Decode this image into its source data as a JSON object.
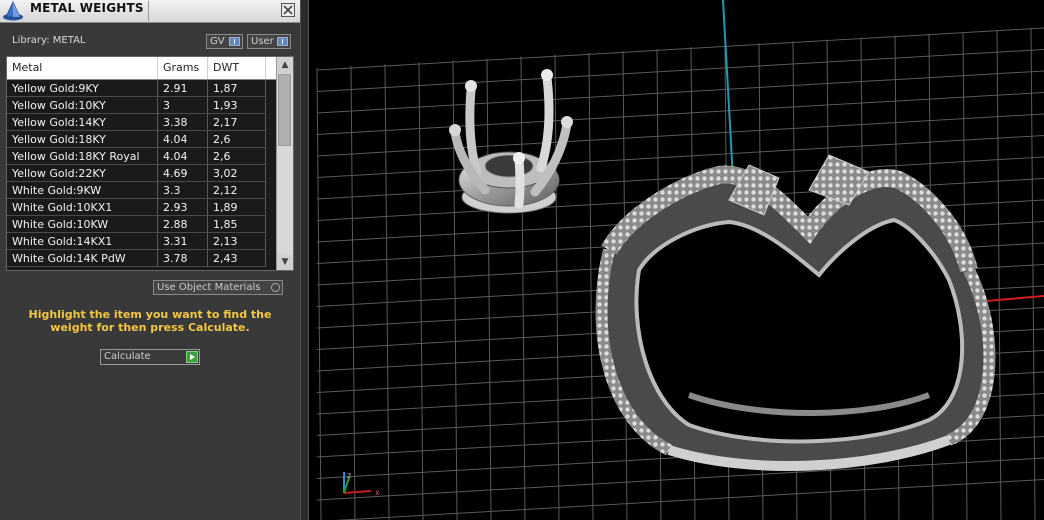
{
  "panel": {
    "title": "METAL WEIGHTS",
    "library_label": "Library: METAL",
    "tag_gv": "GV",
    "tag_user": "User",
    "use_object_materials": "Use Object Materials",
    "hint": "Highlight the item you want to find the weight for then press Calculate.",
    "calculate_label": "Calculate"
  },
  "table": {
    "columns": [
      "Metal",
      "Grams",
      "DWT"
    ],
    "rows": [
      [
        "Yellow Gold:9KY",
        "2.91",
        "1,87"
      ],
      [
        "Yellow Gold:10KY",
        "3",
        "1,93"
      ],
      [
        "Yellow Gold:14KY",
        "3.38",
        "2,17"
      ],
      [
        "Yellow Gold:18KY",
        "4.04",
        "2,6"
      ],
      [
        "Yellow Gold:18KY Royal",
        "4.04",
        "2,6"
      ],
      [
        "Yellow Gold:22KY",
        "4.69",
        "3,02"
      ],
      [
        "White Gold:9KW",
        "3.3",
        "2,12"
      ],
      [
        "White Gold:10KX1",
        "2.93",
        "1,89"
      ],
      [
        "White Gold:10KW",
        "2.88",
        "1,85"
      ],
      [
        "White Gold:14KX1",
        "3.31",
        "2,13"
      ],
      [
        "White Gold:14K PdW",
        "3.78",
        "2,43"
      ]
    ]
  },
  "icons": {
    "app": "app-pyramid-icon",
    "close": "close-icon",
    "scroll_up": "chevron-up-icon",
    "scroll_down": "chevron-down-icon",
    "go": "play-icon"
  },
  "colors": {
    "hint": "#f5c842",
    "axis_x": "#d21e1e",
    "axis_y": "#1e9ab4",
    "grid": "#5a5a5a"
  }
}
